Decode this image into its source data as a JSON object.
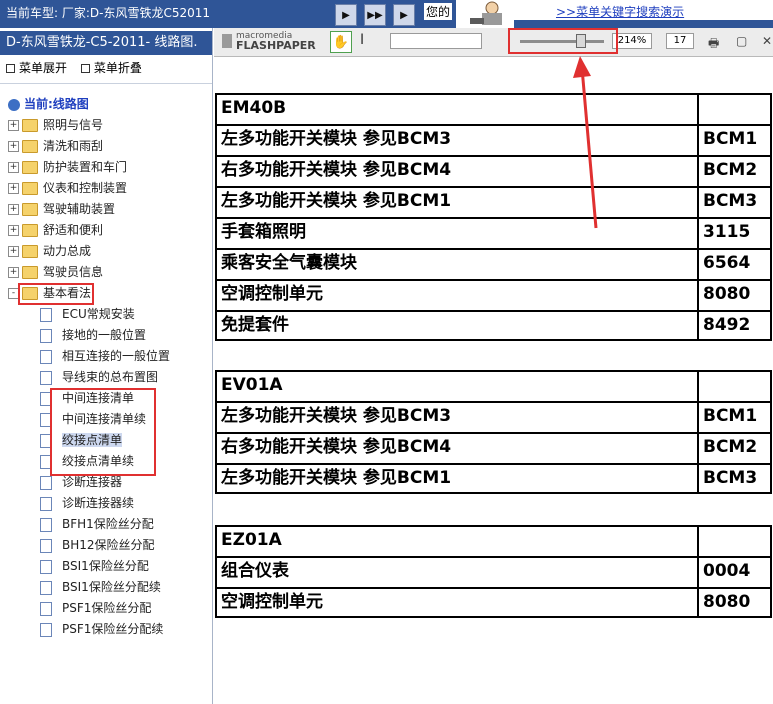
{
  "topbar": {
    "car_label": "当前车型:  厂家:D-东风雪铁龙C52011",
    "hello": "您的",
    "demo_link": ">>菜单关键字搜索演示"
  },
  "left": {
    "title": "D-东风雪铁龙-C5-2011- 线路图.",
    "expand": "菜单展开",
    "collapse": "菜单折叠",
    "root": "当前:线路图",
    "folders": [
      "照明与信号",
      "清洗和雨刮",
      "防护装置和车门",
      "仪表和控制装置",
      "驾驶辅助装置",
      "舒适和便利",
      "动力总成",
      "驾驶员信息"
    ],
    "open_folder": "基本看法",
    "pages": [
      "ECU常规安装",
      "接地的一般位置",
      "相互连接的一般位置",
      "导线束的总布置图",
      "中间连接清单",
      "中间连接清单续",
      "绞接点清单",
      "绞接点清单续",
      "诊断连接器",
      "诊断连接器续",
      "BFH1保险丝分配",
      "BH12保险丝分配",
      "BSI1保险丝分配",
      "BSI1保险丝分配续",
      "PSF1保险丝分配",
      "PSF1保险丝分配续"
    ]
  },
  "toolbar": {
    "brand_small": "macromedia",
    "brand_big": "FLASHPAPER",
    "zoom": "214%",
    "page": "17",
    "zoom_level": 0.75
  },
  "content": {
    "sections": [
      {
        "header": "EM40B",
        "rows": [
          {
            "name": "左多功能开关模块 参见BCM3",
            "code": "BCM1"
          },
          {
            "name": "右多功能开关模块 参见BCM4",
            "code": "BCM2"
          },
          {
            "name": "左多功能开关模块 参见BCM1",
            "code": "BCM3"
          },
          {
            "name": "手套箱照明",
            "code": "3115"
          },
          {
            "name": "乘客安全气囊模块",
            "code": "6564"
          },
          {
            "name": "空调控制单元",
            "code": "8080"
          },
          {
            "name": "免提套件",
            "code": "8492"
          }
        ]
      },
      {
        "header": "EV01A",
        "rows": [
          {
            "name": "左多功能开关模块 参见BCM3",
            "code": "BCM1"
          },
          {
            "name": "右多功能开关模块 参见BCM4",
            "code": "BCM2"
          },
          {
            "name": "左多功能开关模块 参见BCM1",
            "code": "BCM3"
          }
        ]
      },
      {
        "header": "EZ01A",
        "rows": [
          {
            "name": "组合仪表",
            "code": "0004"
          },
          {
            "name": "空调控制单元",
            "code": "8080"
          }
        ]
      }
    ]
  },
  "colors": {
    "brand_blue": "#2f5597",
    "annotation_red": "#e03030"
  }
}
